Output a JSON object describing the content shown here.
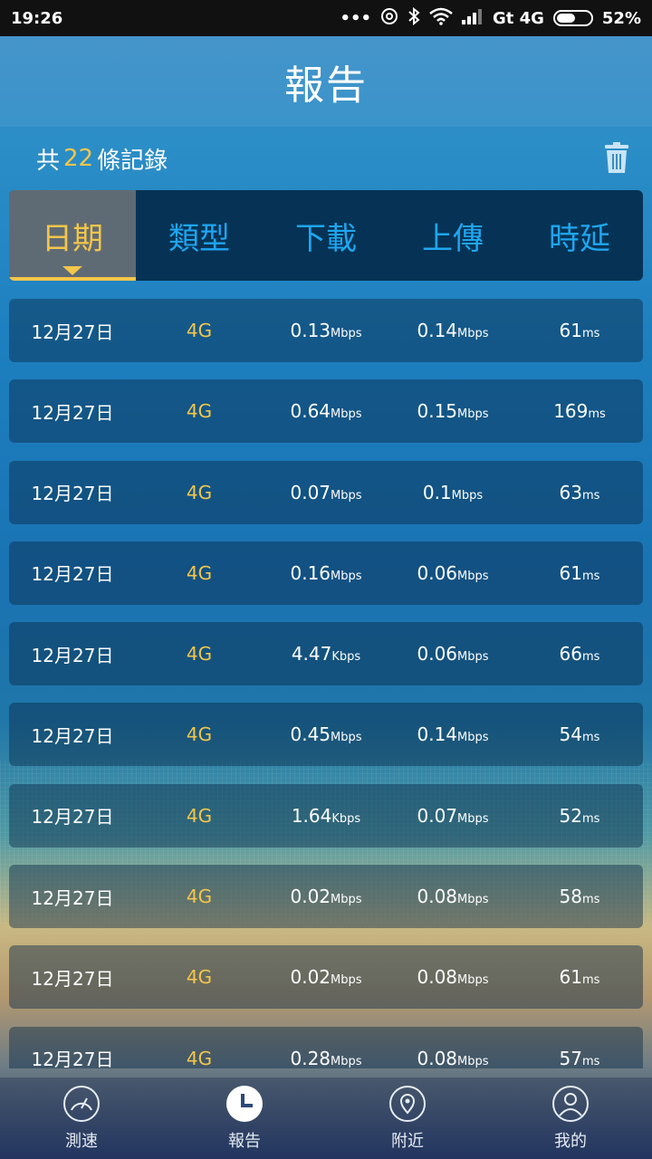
{
  "status_bar": {
    "time": "19:26",
    "network": "Gt 4G",
    "battery": "52%",
    "icons": [
      "more-icon",
      "hotspot-icon",
      "bluetooth-icon",
      "wifi-icon",
      "signal-icon",
      "battery-icon"
    ]
  },
  "header": {
    "title": "報告"
  },
  "records": {
    "prefix": "共",
    "count": "22",
    "suffix": "條記錄",
    "trash_icon": "trash-icon"
  },
  "columns": [
    {
      "label": "日期",
      "active": true
    },
    {
      "label": "類型",
      "active": false
    },
    {
      "label": "下載",
      "active": false
    },
    {
      "label": "上傳",
      "active": false
    },
    {
      "label": "時延",
      "active": false
    }
  ],
  "rows": [
    {
      "date": "12月27日",
      "type": "4G",
      "down": "0.13",
      "down_unit": "Mbps",
      "up": "0.14",
      "up_unit": "Mbps",
      "latency": "61",
      "latency_unit": "ms"
    },
    {
      "date": "12月27日",
      "type": "4G",
      "down": "0.64",
      "down_unit": "Mbps",
      "up": "0.15",
      "up_unit": "Mbps",
      "latency": "169",
      "latency_unit": "ms"
    },
    {
      "date": "12月27日",
      "type": "4G",
      "down": "0.07",
      "down_unit": "Mbps",
      "up": "0.1",
      "up_unit": "Mbps",
      "latency": "63",
      "latency_unit": "ms"
    },
    {
      "date": "12月27日",
      "type": "4G",
      "down": "0.16",
      "down_unit": "Mbps",
      "up": "0.06",
      "up_unit": "Mbps",
      "latency": "61",
      "latency_unit": "ms"
    },
    {
      "date": "12月27日",
      "type": "4G",
      "down": "4.47",
      "down_unit": "Kbps",
      "up": "0.06",
      "up_unit": "Mbps",
      "latency": "66",
      "latency_unit": "ms"
    },
    {
      "date": "12月27日",
      "type": "4G",
      "down": "0.45",
      "down_unit": "Mbps",
      "up": "0.14",
      "up_unit": "Mbps",
      "latency": "54",
      "latency_unit": "ms"
    },
    {
      "date": "12月27日",
      "type": "4G",
      "down": "1.64",
      "down_unit": "Kbps",
      "up": "0.07",
      "up_unit": "Mbps",
      "latency": "52",
      "latency_unit": "ms"
    },
    {
      "date": "12月27日",
      "type": "4G",
      "down": "0.02",
      "down_unit": "Mbps",
      "up": "0.08",
      "up_unit": "Mbps",
      "latency": "58",
      "latency_unit": "ms"
    },
    {
      "date": "12月27日",
      "type": "4G",
      "down": "0.02",
      "down_unit": "Mbps",
      "up": "0.08",
      "up_unit": "Mbps",
      "latency": "61",
      "latency_unit": "ms"
    },
    {
      "date": "12月27日",
      "type": "4G",
      "down": "0.28",
      "down_unit": "Mbps",
      "up": "0.08",
      "up_unit": "Mbps",
      "latency": "57",
      "latency_unit": "ms"
    }
  ],
  "nav": [
    {
      "label": "測速",
      "icon": "speedometer-icon",
      "active": false
    },
    {
      "label": "報告",
      "icon": "clock-icon",
      "active": true
    },
    {
      "label": "附近",
      "icon": "location-pin-icon",
      "active": false
    },
    {
      "label": "我的",
      "icon": "user-icon",
      "active": false
    }
  ],
  "colors": {
    "accent": "#f4c64a",
    "column_label": "#1fa6f0",
    "header_bar": "#063355"
  }
}
